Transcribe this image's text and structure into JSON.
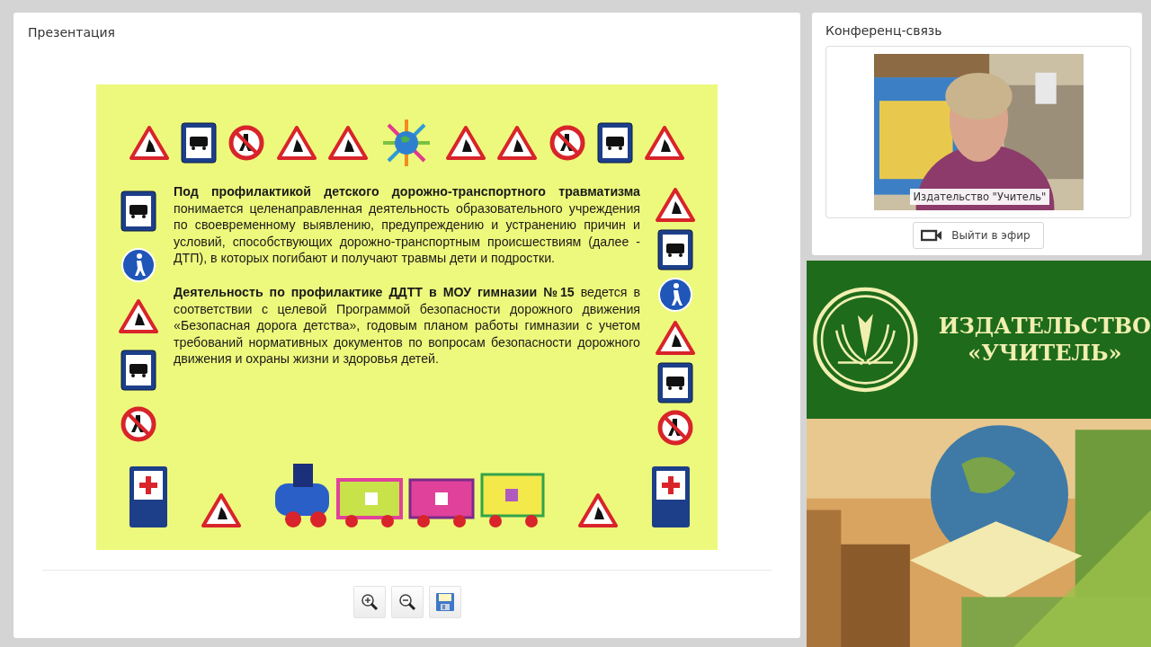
{
  "presentation": {
    "title": "Презентация",
    "slide": {
      "paragraphs": [
        "**Под профилактикой детского дорожно-транспортного травматизма** понимается целенаправленная деятельность образовательного учреждения по своевременному выявлению, предупреждению и устранению причин и условий, способствующих дорожно-транспортным происшествиям (далее - ДТП), в которых погибают и получают травмы дети и подростки.",
        "**Деятельность по профилактике ДДТТ в МОУ гимназии №15** ведется в соответствии с целевой Программой безопасности дорожного движения «Безопасная дорога детства», годовым планом работы гимназии с учетом требований нормативных документов по вопросам безопасности дорожного движения и охраны жизни и здоровья детей."
      ]
    },
    "toolbar": [
      {
        "kind": "zoom-in"
      },
      {
        "kind": "zoom-out"
      },
      {
        "kind": "save"
      }
    ]
  },
  "conference": {
    "title": "Конференц-связь",
    "video": {
      "kind": "picture",
      "caption": "Издательство \"Учитель\""
    },
    "button": "Выйти в эфир"
  },
  "banner": {
    "lines": [
      "ИЗДАТЕЛЬСТВО",
      "«УЧИТЕЛЬ»"
    ]
  }
}
